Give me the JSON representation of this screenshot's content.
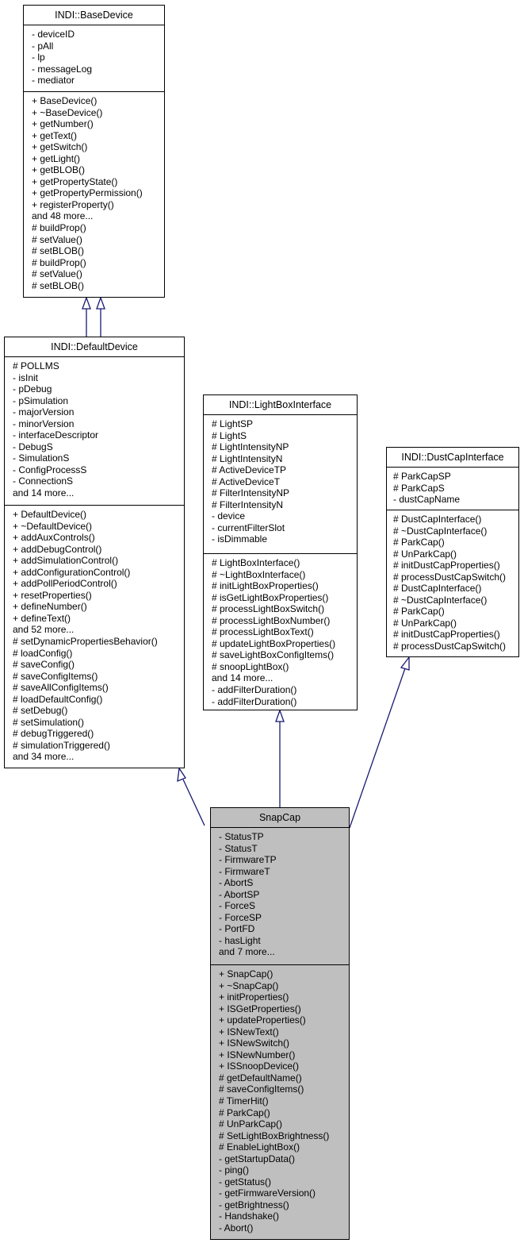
{
  "diagram": {
    "type": "uml-class-inheritance",
    "edge_color": "#191970",
    "focus_fill": "#bfbfbf"
  },
  "classes": {
    "base_device": {
      "name": "INDI::BaseDevice",
      "attributes": [
        "- deviceID",
        "- pAll",
        "- lp",
        "- messageLog",
        "- mediator"
      ],
      "methods": [
        "+ BaseDevice()",
        "+ ~BaseDevice()",
        "+ getNumber()",
        "+ getText()",
        "+ getSwitch()",
        "+ getLight()",
        "+ getBLOB()",
        "+ getPropertyState()",
        "+ getPropertyPermission()",
        "+ registerProperty()",
        "and 48 more...",
        "# buildProp()",
        "# setValue()",
        "# setBLOB()",
        "# buildProp()",
        "# setValue()",
        "# setBLOB()"
      ]
    },
    "default_device": {
      "name": "INDI::DefaultDevice",
      "attributes": [
        "# POLLMS",
        "- isInit",
        "- pDebug",
        "- pSimulation",
        "- majorVersion",
        "- minorVersion",
        "- interfaceDescriptor",
        "- DebugS",
        "- SimulationS",
        "- ConfigProcessS",
        "- ConnectionS",
        "and 14 more..."
      ],
      "methods": [
        "+ DefaultDevice()",
        "+ ~DefaultDevice()",
        "+ addAuxControls()",
        "+ addDebugControl()",
        "+ addSimulationControl()",
        "+ addConfigurationControl()",
        "+ addPollPeriodControl()",
        "+ resetProperties()",
        "+ defineNumber()",
        "+ defineText()",
        "and 52 more...",
        "# setDynamicPropertiesBehavior()",
        "# loadConfig()",
        "# saveConfig()",
        "# saveConfigItems()",
        "# saveAllConfigItems()",
        "# loadDefaultConfig()",
        "# setDebug()",
        "# setSimulation()",
        "# debugTriggered()",
        "# simulationTriggered()",
        "and 34 more..."
      ]
    },
    "light_box_interface": {
      "name": "INDI::LightBoxInterface",
      "attributes": [
        "# LightSP",
        "# LightS",
        "# LightIntensityNP",
        "# LightIntensityN",
        "# ActiveDeviceTP",
        "# ActiveDeviceT",
        "# FilterIntensityNP",
        "# FilterIntensityN",
        "- device",
        "- currentFilterSlot",
        "- isDimmable"
      ],
      "methods": [
        "# LightBoxInterface()",
        "# ~LightBoxInterface()",
        "# initLightBoxProperties()",
        "# isGetLightBoxProperties()",
        "# processLightBoxSwitch()",
        "# processLightBoxNumber()",
        "# processLightBoxText()",
        "# updateLightBoxProperties()",
        "# saveLightBoxConfigItems()",
        "# snoopLightBox()",
        "and 14 more...",
        "- addFilterDuration()",
        "- addFilterDuration()"
      ]
    },
    "dust_cap_interface": {
      "name": "INDI::DustCapInterface",
      "attributes": [
        "# ParkCapSP",
        "# ParkCapS",
        "- dustCapName"
      ],
      "methods": [
        "# DustCapInterface()",
        "# ~DustCapInterface()",
        "# ParkCap()",
        "# UnParkCap()",
        "# initDustCapProperties()",
        "# processDustCapSwitch()",
        "# DustCapInterface()",
        "# ~DustCapInterface()",
        "# ParkCap()",
        "# UnParkCap()",
        "# initDustCapProperties()",
        "# processDustCapSwitch()"
      ]
    },
    "snap_cap": {
      "name": "SnapCap",
      "attributes": [
        "- StatusTP",
        "- StatusT",
        "- FirmwareTP",
        "- FirmwareT",
        "- AbortS",
        "- AbortSP",
        "- ForceS",
        "- ForceSP",
        "- PortFD",
        "- hasLight",
        "and 7 more..."
      ],
      "methods": [
        "+ SnapCap()",
        "+ ~SnapCap()",
        "+ initProperties()",
        "+ ISGetProperties()",
        "+ updateProperties()",
        "+ ISNewText()",
        "+ ISNewSwitch()",
        "+ ISNewNumber()",
        "+ ISSnoopDevice()",
        "# getDefaultName()",
        "# saveConfigItems()",
        "# TimerHit()",
        "# ParkCap()",
        "# UnParkCap()",
        "# SetLightBoxBrightness()",
        "# EnableLightBox()",
        "- getStartupData()",
        "- ping()",
        "- getStatus()",
        "- getFirmwareVersion()",
        "- getBrightness()",
        "- Handshake()",
        "- Abort()"
      ]
    }
  },
  "inheritance": [
    {
      "child": "INDI::DefaultDevice",
      "parent": "INDI::BaseDevice"
    },
    {
      "child": "INDI::DefaultDevice",
      "parent": "INDI::BaseDevice"
    },
    {
      "child": "SnapCap",
      "parent": "INDI::DefaultDevice"
    },
    {
      "child": "SnapCap",
      "parent": "INDI::LightBoxInterface"
    },
    {
      "child": "SnapCap",
      "parent": "INDI::DustCapInterface"
    }
  ]
}
